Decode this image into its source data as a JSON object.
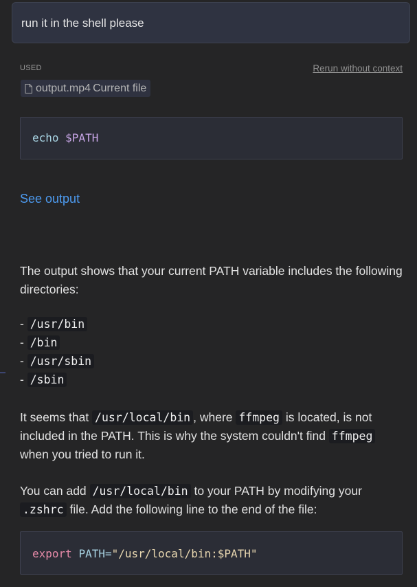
{
  "user_message": "run it in the shell please",
  "context": {
    "used_label": "USED",
    "rerun_label": "Rerun without context",
    "file_chip": {
      "icon": "file-icon",
      "name": "output.mp4",
      "tag": "Current file"
    }
  },
  "command_block": {
    "command": "echo",
    "argument": "$PATH"
  },
  "see_output_label": "See output",
  "response": {
    "intro": "The output shows that your current PATH variable includes the following directories:",
    "dirs": [
      "/usr/bin",
      "/bin",
      "/usr/sbin",
      "/sbin"
    ],
    "dir_bullet": "- ",
    "p2": {
      "a": "It seems that ",
      "code1": "/usr/local/bin",
      "b": ", where ",
      "code2": "ffmpeg",
      "c": " is located, is not included in the PATH. This is why the system couldn't find ",
      "code3": "ffmpeg",
      "d": " when you tried to run it."
    },
    "p3": {
      "a": "You can add ",
      "code1": "/usr/local/bin",
      "b": " to your PATH by modifying your ",
      "code2": ".zshrc",
      "c": " file. Add the following line to the end of the file:"
    }
  },
  "export_block": {
    "keyword": "export",
    "name": "PATH",
    "eq": "=",
    "value": "\"/usr/local/bin:$PATH\""
  },
  "colors": {
    "link": "#4d9bf0",
    "background": "#252526",
    "code_keyword": "#e58aa8"
  }
}
